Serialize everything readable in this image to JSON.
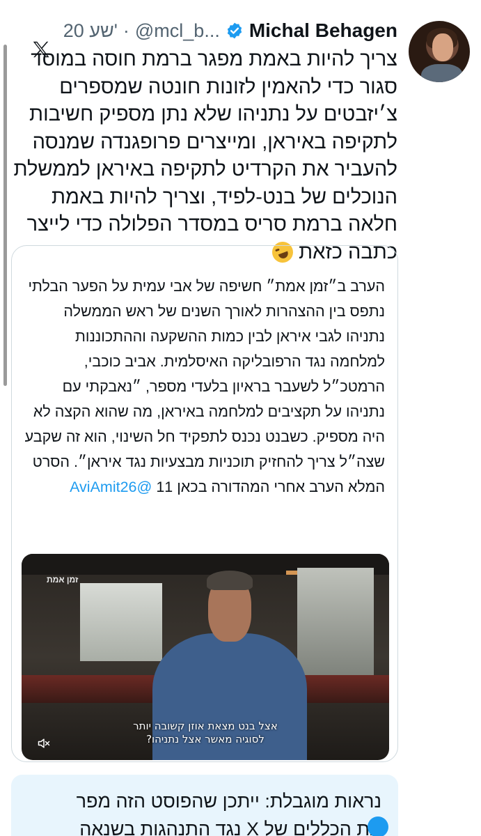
{
  "author": {
    "display_name": "Michal Behagen",
    "handle": "@mcl_b...",
    "separator": "·",
    "timestamp": "20 שע'"
  },
  "tweet": {
    "text": "צריך להיות באמת מפגר ברמת חוסה במוסד סגור כדי להאמין לזונות חונטה שמספרים צ׳יזבטים על נתניהו שלא נתן מספיק חשיבות לתקיפה באיראן, ומייצרים פרופגנדה שמנסה להעביר את הקרדיט לתקיפה באיראן לממשלת הנוכלים של בנט-לפיד, וצריך להיות באמת חלאה ברמת סריס במסדר הפלולה כדי לייצר כתבה כזאת"
  },
  "quoted": {
    "text": "הערב ב״זמן אמת״ חשיפה של אבי עמית על הפער הבלתי נתפס בין ההצהרות לאורך השנים של ראש הממשלה נתניהו לגבי איראן לבין כמות ההשקעה וההתכוננות למלחמה נגד הרפובליקה האיסלמית. אביב כוכבי, הרמטכ״ל לשעבר בראיון בלעדי מספר, ״נאבקתי עם נתניהו על תקציבים למלחמה באיראן, מה שהוא הקצה לא היה מספיק. כשבנט נכנס לתפקיד חל השינוי, הוא זה שקבע שצה״ל צריך להחזיק תוכניות מבצעיות נגד איראן״. הסרט המלא הערב אחרי המהדורה בכאן 11",
    "mention": "@AviAmit26",
    "video": {
      "watermark": "זמן אמת",
      "subtitle_line1": "אצל בנט מצאת אוזן קשובה יותר",
      "subtitle_line2": "לסוגיה מאשר אצל נתניהו?"
    }
  },
  "notice": {
    "text": "נראות מוגבלת: ייתכן שהפוסט הזה מפר את הכללים של X נגד התנהגות בשנאה"
  },
  "icons": {
    "x_logo": "x-logo-icon",
    "verified": "verified-badge-icon",
    "mute": "mute-icon",
    "info": "info-icon",
    "emoji": "rolling-laughing-emoji-icon"
  },
  "colors": {
    "link": "#1d9bf0",
    "muted_text": "#536471",
    "notice_bg": "#e8f5fd"
  }
}
